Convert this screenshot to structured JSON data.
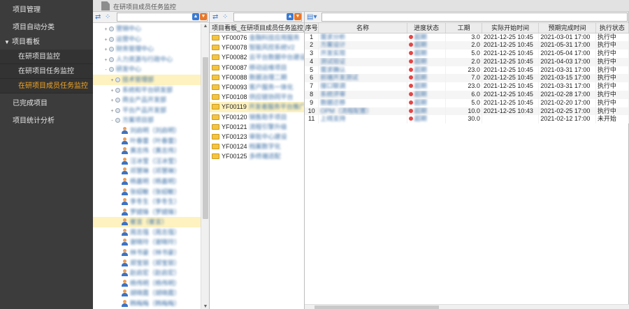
{
  "sidebar": {
    "items": [
      {
        "label": "项目管理",
        "kind": "top"
      },
      {
        "label": "项目自动分类",
        "kind": "top"
      },
      {
        "label": "项目看板",
        "kind": "group",
        "caret": "▼"
      },
      {
        "label": "在研项目监控",
        "kind": "sub"
      },
      {
        "label": "在研项目任务监控",
        "kind": "sub"
      },
      {
        "label": "在研项目成员任务监控",
        "kind": "sub",
        "active": true
      },
      {
        "label": "已完成项目",
        "kind": "top"
      },
      {
        "label": "项目统计分析",
        "kind": "top"
      }
    ]
  },
  "header": {
    "title": "在研项目成员任务监控"
  },
  "tree": {
    "scroll_up": "▲",
    "scroll_down": "▼",
    "nodes": [
      {
        "type": "dot",
        "depth": 2,
        "exp": "+",
        "label": "营销中心"
      },
      {
        "type": "dot",
        "depth": 2,
        "exp": "+",
        "label": "运营中心"
      },
      {
        "type": "dot",
        "depth": 2,
        "exp": "+",
        "label": "财务管理中心"
      },
      {
        "type": "dot",
        "depth": 2,
        "exp": "+",
        "label": "人力资源与行政中心"
      },
      {
        "type": "dot",
        "depth": 2,
        "exp": "-",
        "label": "研发中心"
      },
      {
        "type": "dot",
        "depth": 3,
        "exp": "+",
        "label": "技术管理部",
        "sel": true
      },
      {
        "type": "dot",
        "depth": 3,
        "exp": "+",
        "label": "系统和平台研发部"
      },
      {
        "type": "dot",
        "depth": 3,
        "exp": "+",
        "label": "商业产品开发部"
      },
      {
        "type": "dot",
        "depth": 3,
        "exp": "+",
        "label": "平台产品开发部"
      },
      {
        "type": "dot",
        "depth": 3,
        "exp": "-",
        "label": "方案项目部"
      },
      {
        "type": "person",
        "depth": 4,
        "label": "刘启明（刘启明）"
      },
      {
        "type": "person",
        "depth": 4,
        "label": "叶春蕾（叶春蕾）"
      },
      {
        "type": "person",
        "depth": 4,
        "label": "黄志伟（黄志伟）"
      },
      {
        "type": "person",
        "depth": 4,
        "label": "汪冰莹（汪冰莹）"
      },
      {
        "type": "person",
        "depth": 4,
        "label": "邓慧琳（邓慧琳）"
      },
      {
        "type": "person",
        "depth": 4,
        "label": "杨嘉明（杨嘉明）"
      },
      {
        "type": "person",
        "depth": 4,
        "label": "张绍敏（张绍敏）"
      },
      {
        "type": "person",
        "depth": 4,
        "label": "李冬生（李冬生）"
      },
      {
        "type": "person",
        "depth": 4,
        "label": "罗婧锋（罗婧锋）"
      },
      {
        "type": "person",
        "depth": 4,
        "label": "崔言（崔言）",
        "sel": true
      },
      {
        "type": "person",
        "depth": 4,
        "label": "周志强（周志强）"
      },
      {
        "type": "person",
        "depth": 4,
        "label": "谢晓玲（谢晓玲）"
      },
      {
        "type": "person",
        "depth": 4,
        "label": "林书豪（林书豪）"
      },
      {
        "type": "person",
        "depth": 4,
        "label": "郑宝丽（郑宝丽）"
      },
      {
        "type": "person",
        "depth": 4,
        "label": "赵启宏（赵启宏）"
      },
      {
        "type": "person",
        "depth": 4,
        "label": "杨伟明（杨伟明）"
      },
      {
        "type": "person",
        "depth": 4,
        "label": "胡晓霞（胡晓霞）"
      },
      {
        "type": "person",
        "depth": 4,
        "label": "韩梅梅（韩梅梅）"
      },
      {
        "type": "person",
        "depth": 4,
        "label": "顾家宁（顾家宁）"
      }
    ]
  },
  "projects": {
    "header": "项目看板_在研项目成员任务监控_I",
    "rows": [
      {
        "code": "YF00076",
        "name": "金融科技应用服务"
      },
      {
        "code": "YF00078",
        "name": "智能风控系统V2"
      },
      {
        "code": "YF00082",
        "name": "云平台数据中台建设"
      },
      {
        "code": "YF00087",
        "name": "移动运维项目"
      },
      {
        "code": "YF00088",
        "name": "数据治理二期"
      },
      {
        "code": "YF00093",
        "name": "客户服务一体化"
      },
      {
        "code": "YF00108",
        "name": "供应链协同平台"
      },
      {
        "code": "YF00119",
        "name": "开发者服务平台推广",
        "sel": true
      },
      {
        "code": "YF00120",
        "name": "销售助手项目"
      },
      {
        "code": "YF00121",
        "name": "流程引擎升级"
      },
      {
        "code": "YF00123",
        "name": "审批中心建设"
      },
      {
        "code": "YF00124",
        "name": "档案数字化"
      },
      {
        "code": "YF00125",
        "name": "多终端适配"
      }
    ]
  },
  "tasks": {
    "columns": [
      "序号",
      "名称",
      "进度状态",
      "工期",
      "实际开始时间",
      "预期完成时间",
      "执行状态"
    ],
    "rows": [
      {
        "seq": "1",
        "name": "需求分析",
        "progress": "超期",
        "duration": "3.0",
        "start": "2021-12-25 10:45",
        "end": "2021-03-01 17:00",
        "status": "执行中"
      },
      {
        "seq": "2",
        "name": "方案设计",
        "progress": "超期",
        "duration": "2.0",
        "start": "2021-12-25 10:45",
        "end": "2021-05-31 17:00",
        "status": "执行中"
      },
      {
        "seq": "3",
        "name": "开发实现",
        "progress": "超期",
        "duration": "5.0",
        "start": "2021-12-25 10:45",
        "end": "2021-05-04 17:00",
        "status": "执行中"
      },
      {
        "seq": "4",
        "name": "测试验证",
        "progress": "超期",
        "duration": "2.0",
        "start": "2021-12-25 10:45",
        "end": "2021-04-03 17:00",
        "status": "执行中"
      },
      {
        "seq": "5",
        "name": "需求确认",
        "progress": "超期",
        "duration": "23.0",
        "start": "2021-12-25 10:45",
        "end": "2021-03-31 17:00",
        "status": "执行中"
      },
      {
        "seq": "6",
        "name": "前端开发测试",
        "progress": "超期",
        "duration": "7.0",
        "start": "2021-12-25 10:45",
        "end": "2021-03-15 17:00",
        "status": "执行中"
      },
      {
        "seq": "7",
        "name": "接口联调",
        "progress": "超期",
        "duration": "23.0",
        "start": "2021-12-25 10:45",
        "end": "2021-03-31 17:00",
        "status": "执行中"
      },
      {
        "seq": "8",
        "name": "系统评审",
        "progress": "超期",
        "duration": "6.0",
        "start": "2021-12-25 10:45",
        "end": "2021-02-28 17:00",
        "status": "执行中"
      },
      {
        "seq": "9",
        "name": "数据迁移",
        "progress": "超期",
        "duration": "5.0",
        "start": "2021-12-25 10:45",
        "end": "2021-02-20 17:00",
        "status": "执行中"
      },
      {
        "seq": "10",
        "name": "OPM（流程配置）",
        "progress": "超期",
        "duration": "10.0",
        "start": "2021-12-25 10:43",
        "end": "2021-02-25 17:00",
        "status": "执行中"
      },
      {
        "seq": "11",
        "name": "上线支持",
        "progress": "超期",
        "duration": "30.0",
        "start": "",
        "end": "2021-02-12 17:00",
        "status": "未开始"
      }
    ]
  },
  "colors": {
    "sidebar_bg": "#3c3c3c",
    "active": "#f5a623",
    "overdue": "#e54545",
    "selected": "#fdf2c0"
  }
}
